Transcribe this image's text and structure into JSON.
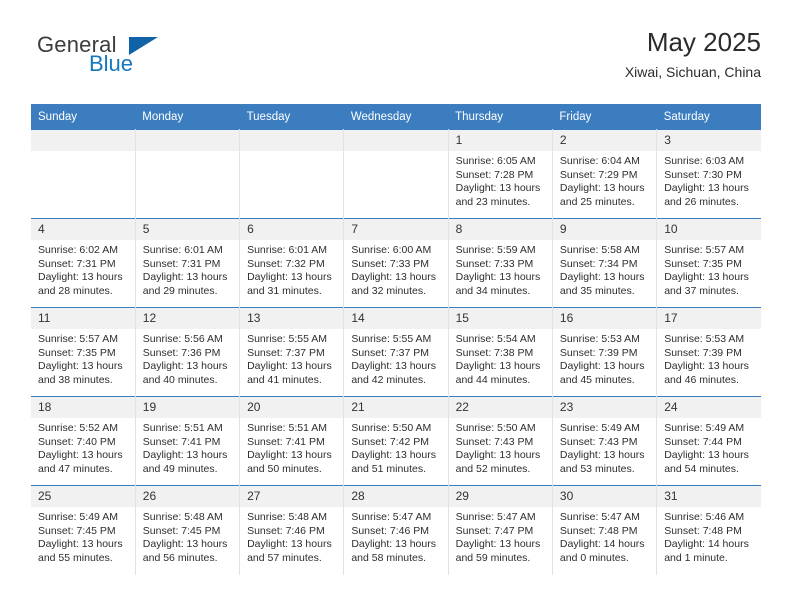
{
  "brand": {
    "word_one": "General",
    "word_two": "Blue",
    "triangle_color": "#0f63a6",
    "accent_color": "#1478be"
  },
  "header": {
    "title": "May 2025",
    "subtitle": "Xiwai, Sichuan, China"
  },
  "calendar": {
    "header_background": "#3b7dbf",
    "daynum_background": "#f1f1f1",
    "weekday_names": [
      "Sunday",
      "Monday",
      "Tuesday",
      "Wednesday",
      "Thursday",
      "Friday",
      "Saturday"
    ],
    "weeks": [
      [
        {
          "day": "",
          "blank": true,
          "sunrise": "",
          "sunset": "",
          "daylight_line1": "",
          "daylight_line2": ""
        },
        {
          "day": "",
          "blank": true,
          "sunrise": "",
          "sunset": "",
          "daylight_line1": "",
          "daylight_line2": ""
        },
        {
          "day": "",
          "blank": true,
          "sunrise": "",
          "sunset": "",
          "daylight_line1": "",
          "daylight_line2": ""
        },
        {
          "day": "",
          "blank": true,
          "sunrise": "",
          "sunset": "",
          "daylight_line1": "",
          "daylight_line2": ""
        },
        {
          "day": "1",
          "blank": false,
          "sunrise": "Sunrise: 6:05 AM",
          "sunset": "Sunset: 7:28 PM",
          "daylight_line1": "Daylight: 13 hours",
          "daylight_line2": "and 23 minutes."
        },
        {
          "day": "2",
          "blank": false,
          "sunrise": "Sunrise: 6:04 AM",
          "sunset": "Sunset: 7:29 PM",
          "daylight_line1": "Daylight: 13 hours",
          "daylight_line2": "and 25 minutes."
        },
        {
          "day": "3",
          "blank": false,
          "sunrise": "Sunrise: 6:03 AM",
          "sunset": "Sunset: 7:30 PM",
          "daylight_line1": "Daylight: 13 hours",
          "daylight_line2": "and 26 minutes."
        }
      ],
      [
        {
          "day": "4",
          "blank": false,
          "sunrise": "Sunrise: 6:02 AM",
          "sunset": "Sunset: 7:31 PM",
          "daylight_line1": "Daylight: 13 hours",
          "daylight_line2": "and 28 minutes."
        },
        {
          "day": "5",
          "blank": false,
          "sunrise": "Sunrise: 6:01 AM",
          "sunset": "Sunset: 7:31 PM",
          "daylight_line1": "Daylight: 13 hours",
          "daylight_line2": "and 29 minutes."
        },
        {
          "day": "6",
          "blank": false,
          "sunrise": "Sunrise: 6:01 AM",
          "sunset": "Sunset: 7:32 PM",
          "daylight_line1": "Daylight: 13 hours",
          "daylight_line2": "and 31 minutes."
        },
        {
          "day": "7",
          "blank": false,
          "sunrise": "Sunrise: 6:00 AM",
          "sunset": "Sunset: 7:33 PM",
          "daylight_line1": "Daylight: 13 hours",
          "daylight_line2": "and 32 minutes."
        },
        {
          "day": "8",
          "blank": false,
          "sunrise": "Sunrise: 5:59 AM",
          "sunset": "Sunset: 7:33 PM",
          "daylight_line1": "Daylight: 13 hours",
          "daylight_line2": "and 34 minutes."
        },
        {
          "day": "9",
          "blank": false,
          "sunrise": "Sunrise: 5:58 AM",
          "sunset": "Sunset: 7:34 PM",
          "daylight_line1": "Daylight: 13 hours",
          "daylight_line2": "and 35 minutes."
        },
        {
          "day": "10",
          "blank": false,
          "sunrise": "Sunrise: 5:57 AM",
          "sunset": "Sunset: 7:35 PM",
          "daylight_line1": "Daylight: 13 hours",
          "daylight_line2": "and 37 minutes."
        }
      ],
      [
        {
          "day": "11",
          "blank": false,
          "sunrise": "Sunrise: 5:57 AM",
          "sunset": "Sunset: 7:35 PM",
          "daylight_line1": "Daylight: 13 hours",
          "daylight_line2": "and 38 minutes."
        },
        {
          "day": "12",
          "blank": false,
          "sunrise": "Sunrise: 5:56 AM",
          "sunset": "Sunset: 7:36 PM",
          "daylight_line1": "Daylight: 13 hours",
          "daylight_line2": "and 40 minutes."
        },
        {
          "day": "13",
          "blank": false,
          "sunrise": "Sunrise: 5:55 AM",
          "sunset": "Sunset: 7:37 PM",
          "daylight_line1": "Daylight: 13 hours",
          "daylight_line2": "and 41 minutes."
        },
        {
          "day": "14",
          "blank": false,
          "sunrise": "Sunrise: 5:55 AM",
          "sunset": "Sunset: 7:37 PM",
          "daylight_line1": "Daylight: 13 hours",
          "daylight_line2": "and 42 minutes."
        },
        {
          "day": "15",
          "blank": false,
          "sunrise": "Sunrise: 5:54 AM",
          "sunset": "Sunset: 7:38 PM",
          "daylight_line1": "Daylight: 13 hours",
          "daylight_line2": "and 44 minutes."
        },
        {
          "day": "16",
          "blank": false,
          "sunrise": "Sunrise: 5:53 AM",
          "sunset": "Sunset: 7:39 PM",
          "daylight_line1": "Daylight: 13 hours",
          "daylight_line2": "and 45 minutes."
        },
        {
          "day": "17",
          "blank": false,
          "sunrise": "Sunrise: 5:53 AM",
          "sunset": "Sunset: 7:39 PM",
          "daylight_line1": "Daylight: 13 hours",
          "daylight_line2": "and 46 minutes."
        }
      ],
      [
        {
          "day": "18",
          "blank": false,
          "sunrise": "Sunrise: 5:52 AM",
          "sunset": "Sunset: 7:40 PM",
          "daylight_line1": "Daylight: 13 hours",
          "daylight_line2": "and 47 minutes."
        },
        {
          "day": "19",
          "blank": false,
          "sunrise": "Sunrise: 5:51 AM",
          "sunset": "Sunset: 7:41 PM",
          "daylight_line1": "Daylight: 13 hours",
          "daylight_line2": "and 49 minutes."
        },
        {
          "day": "20",
          "blank": false,
          "sunrise": "Sunrise: 5:51 AM",
          "sunset": "Sunset: 7:41 PM",
          "daylight_line1": "Daylight: 13 hours",
          "daylight_line2": "and 50 minutes."
        },
        {
          "day": "21",
          "blank": false,
          "sunrise": "Sunrise: 5:50 AM",
          "sunset": "Sunset: 7:42 PM",
          "daylight_line1": "Daylight: 13 hours",
          "daylight_line2": "and 51 minutes."
        },
        {
          "day": "22",
          "blank": false,
          "sunrise": "Sunrise: 5:50 AM",
          "sunset": "Sunset: 7:43 PM",
          "daylight_line1": "Daylight: 13 hours",
          "daylight_line2": "and 52 minutes."
        },
        {
          "day": "23",
          "blank": false,
          "sunrise": "Sunrise: 5:49 AM",
          "sunset": "Sunset: 7:43 PM",
          "daylight_line1": "Daylight: 13 hours",
          "daylight_line2": "and 53 minutes."
        },
        {
          "day": "24",
          "blank": false,
          "sunrise": "Sunrise: 5:49 AM",
          "sunset": "Sunset: 7:44 PM",
          "daylight_line1": "Daylight: 13 hours",
          "daylight_line2": "and 54 minutes."
        }
      ],
      [
        {
          "day": "25",
          "blank": false,
          "sunrise": "Sunrise: 5:49 AM",
          "sunset": "Sunset: 7:45 PM",
          "daylight_line1": "Daylight: 13 hours",
          "daylight_line2": "and 55 minutes."
        },
        {
          "day": "26",
          "blank": false,
          "sunrise": "Sunrise: 5:48 AM",
          "sunset": "Sunset: 7:45 PM",
          "daylight_line1": "Daylight: 13 hours",
          "daylight_line2": "and 56 minutes."
        },
        {
          "day": "27",
          "blank": false,
          "sunrise": "Sunrise: 5:48 AM",
          "sunset": "Sunset: 7:46 PM",
          "daylight_line1": "Daylight: 13 hours",
          "daylight_line2": "and 57 minutes."
        },
        {
          "day": "28",
          "blank": false,
          "sunrise": "Sunrise: 5:47 AM",
          "sunset": "Sunset: 7:46 PM",
          "daylight_line1": "Daylight: 13 hours",
          "daylight_line2": "and 58 minutes."
        },
        {
          "day": "29",
          "blank": false,
          "sunrise": "Sunrise: 5:47 AM",
          "sunset": "Sunset: 7:47 PM",
          "daylight_line1": "Daylight: 13 hours",
          "daylight_line2": "and 59 minutes."
        },
        {
          "day": "30",
          "blank": false,
          "sunrise": "Sunrise: 5:47 AM",
          "sunset": "Sunset: 7:48 PM",
          "daylight_line1": "Daylight: 14 hours",
          "daylight_line2": "and 0 minutes."
        },
        {
          "day": "31",
          "blank": false,
          "sunrise": "Sunrise: 5:46 AM",
          "sunset": "Sunset: 7:48 PM",
          "daylight_line1": "Daylight: 14 hours",
          "daylight_line2": "and 1 minute."
        }
      ]
    ]
  }
}
